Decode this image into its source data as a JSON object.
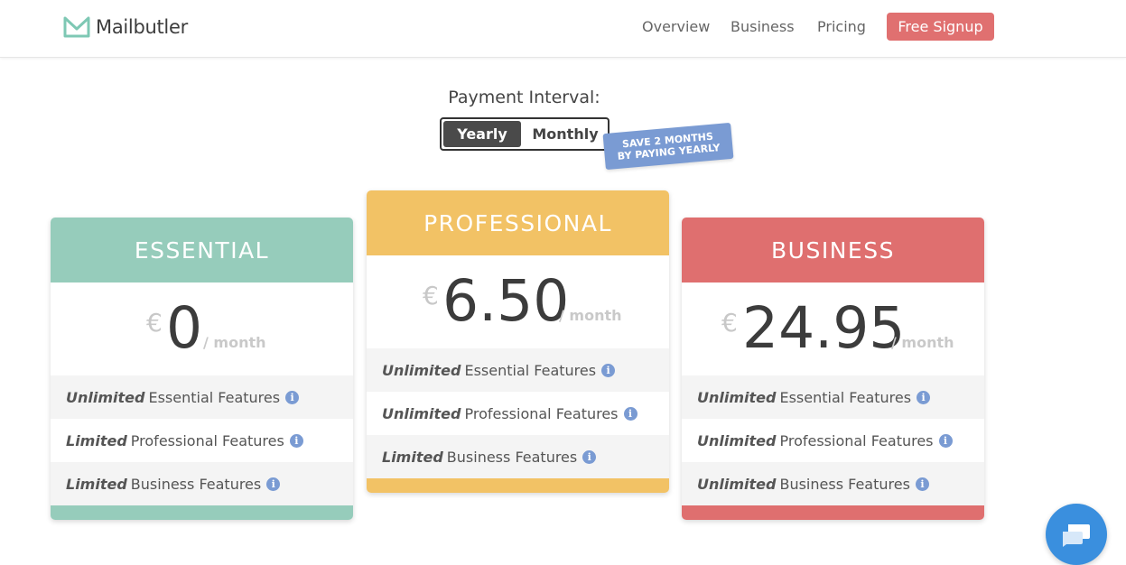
{
  "header": {
    "logo_text": "Mailbutler",
    "nav": [
      "Overview",
      "Business",
      "Pricing"
    ],
    "signup_label": "Free Signup"
  },
  "payment": {
    "label": "Payment Interval:",
    "yearly": "Yearly",
    "monthly": "Monthly",
    "badge_line1": "SAVE 2 MONTHS",
    "badge_line2": "BY PAYING YEARLY"
  },
  "plans": [
    {
      "name": "ESSENTIAL",
      "currency": "€",
      "price": "0",
      "period": "/ month",
      "color": "#96ccbb",
      "features": [
        {
          "lead": "Unlimited",
          "text": "Essential Features"
        },
        {
          "lead": "Limited",
          "text": "Professional Features"
        },
        {
          "lead": "Limited",
          "text": "Business Features"
        }
      ]
    },
    {
      "name": "PROFESSIONAL",
      "currency": "€",
      "price": "6.50",
      "period": "/ month",
      "color": "#f2c265",
      "features": [
        {
          "lead": "Unlimited",
          "text": "Essential Features"
        },
        {
          "lead": "Unlimited",
          "text": "Professional Features"
        },
        {
          "lead": "Limited",
          "text": "Business Features"
        }
      ]
    },
    {
      "name": "BUSINESS",
      "currency": "€",
      "price": "24.95",
      "period": "/ month",
      "color": "#df6f6f",
      "features": [
        {
          "lead": "Unlimited",
          "text": "Essential Features"
        },
        {
          "lead": "Unlimited",
          "text": "Professional Features"
        },
        {
          "lead": "Unlimited",
          "text": "Business Features"
        }
      ]
    }
  ],
  "info_icon": "i",
  "colors": {
    "accent": "#e07070",
    "badge": "#7a9bd3",
    "chat": "#3a8fde"
  }
}
